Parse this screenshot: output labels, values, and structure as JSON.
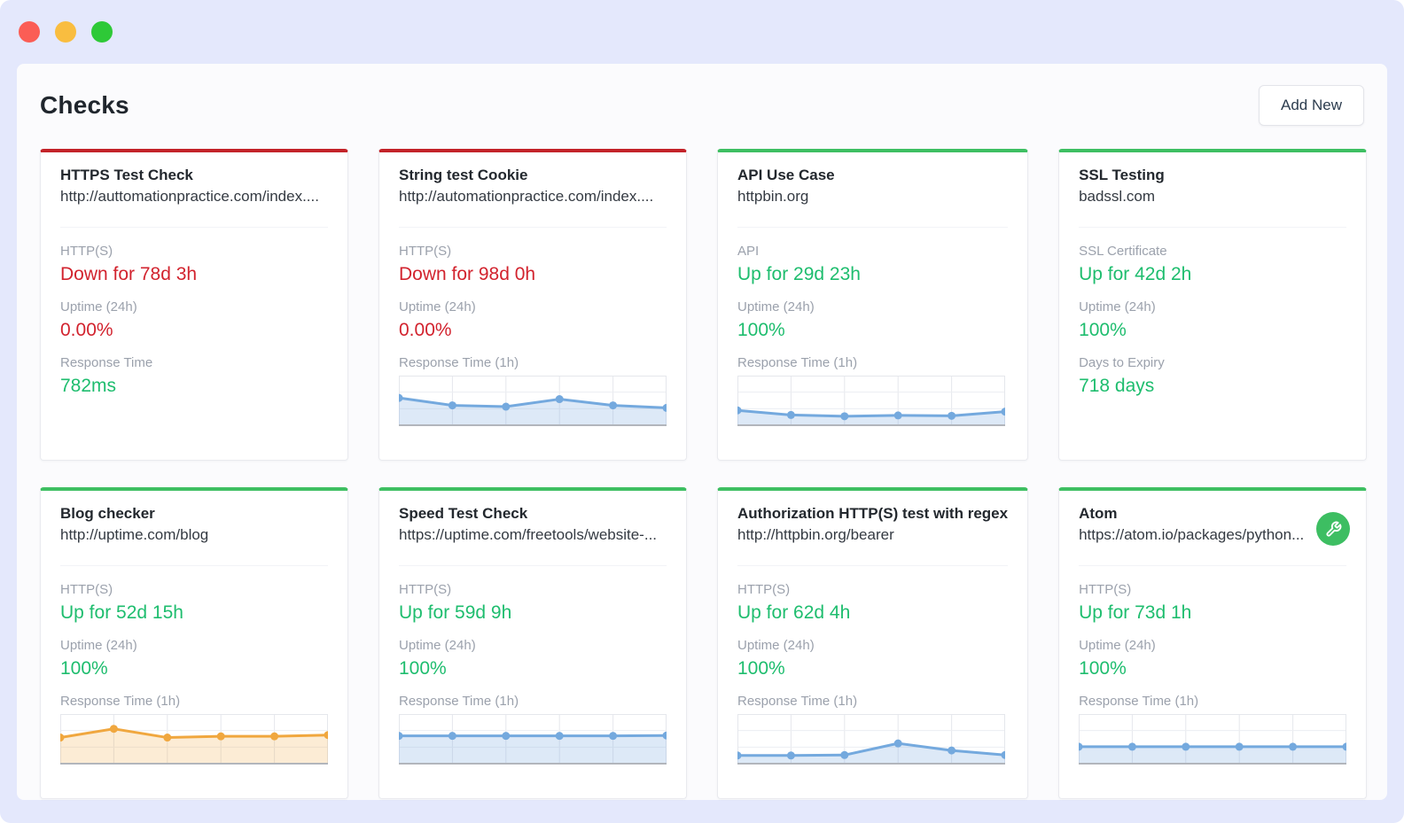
{
  "window": {
    "traffic_lights": [
      "#fb5d55",
      "#f9bd40",
      "#2ec937"
    ]
  },
  "header": {
    "title": "Checks",
    "add_button_label": "Add New"
  },
  "colors": {
    "up_text": "#1ebd6e",
    "down_text": "#d2232e",
    "up_border": "#3ebf62",
    "down_border": "#c32329",
    "label_gray": "#9ba1ac",
    "blue_line": "#74a9de",
    "orange_line": "#f0a73f"
  },
  "cards": [
    {
      "name": "HTTPS Test Check",
      "url": "http://auttomationpractice.com/index....",
      "status": "down",
      "sections": [
        {
          "label": "HTTP(S)",
          "value": "Down for 78d 3h",
          "value_color": "red"
        },
        {
          "label": "Uptime (24h)",
          "value": "0.00%",
          "value_color": "red"
        },
        {
          "label": "Response Time",
          "value": "782ms",
          "value_color": "green"
        }
      ]
    },
    {
      "name": "String test Cookie",
      "url": "http://automationpractice.com/index....",
      "status": "down",
      "sections": [
        {
          "label": "HTTP(S)",
          "value": "Down for 98d 0h",
          "value_color": "red"
        },
        {
          "label": "Uptime (24h)",
          "value": "0.00%",
          "value_color": "red"
        },
        {
          "label": "Response Time (1h)",
          "chart": 0
        }
      ]
    },
    {
      "name": "API Use Case",
      "url": "httpbin.org",
      "status": "up",
      "sections": [
        {
          "label": "API",
          "value": "Up for 29d 23h",
          "value_color": "green"
        },
        {
          "label": "Uptime (24h)",
          "value": "100%",
          "value_color": "green"
        },
        {
          "label": "Response Time (1h)",
          "chart": 1
        }
      ]
    },
    {
      "name": "SSL Testing",
      "url": "badssl.com",
      "status": "up",
      "sections": [
        {
          "label": "SSL Certificate",
          "value": "Up for 42d 2h",
          "value_color": "green"
        },
        {
          "label": "Uptime (24h)",
          "value": "100%",
          "value_color": "green"
        },
        {
          "label": "Days to Expiry",
          "value": "718 days",
          "value_color": "green"
        }
      ]
    },
    {
      "name": "Blog checker",
      "url": "http://uptime.com/blog",
      "status": "up",
      "sections": [
        {
          "label": "HTTP(S)",
          "value": "Up for 52d 15h",
          "value_color": "green"
        },
        {
          "label": "Uptime (24h)",
          "value": "100%",
          "value_color": "green"
        },
        {
          "label": "Response Time (1h)",
          "chart": 2
        }
      ]
    },
    {
      "name": "Speed Test Check",
      "url": "https://uptime.com/freetools/website-...",
      "status": "up",
      "sections": [
        {
          "label": "HTTP(S)",
          "value": "Up for 59d 9h",
          "value_color": "green"
        },
        {
          "label": "Uptime (24h)",
          "value": "100%",
          "value_color": "green"
        },
        {
          "label": "Response Time (1h)",
          "chart": 3
        }
      ]
    },
    {
      "name": "Authorization HTTP(S) test with regex",
      "url": "http://httpbin.org/bearer",
      "status": "up",
      "sections": [
        {
          "label": "HTTP(S)",
          "value": "Up for 62d 4h",
          "value_color": "green"
        },
        {
          "label": "Uptime (24h)",
          "value": "100%",
          "value_color": "green"
        },
        {
          "label": "Response Time (1h)",
          "chart": 4
        }
      ]
    },
    {
      "name": "Atom",
      "url": "https://atom.io/packages/python...",
      "status": "up",
      "badge": "wrench",
      "sections": [
        {
          "label": "HTTP(S)",
          "value": "Up for 73d 1h",
          "value_color": "green"
        },
        {
          "label": "Uptime (24h)",
          "value": "100%",
          "value_color": "green"
        },
        {
          "label": "Response Time (1h)",
          "chart": 5
        }
      ]
    }
  ],
  "chart_data": [
    {
      "type": "area",
      "card": "String test Cookie",
      "title": "Response Time (1h)",
      "color": "#74a9de",
      "fill": "rgba(133,177,227,0.28)",
      "x": [
        0,
        0.2,
        0.4,
        0.6,
        0.8,
        1.0
      ],
      "values": [
        0.55,
        0.37,
        0.34,
        0.52,
        0.37,
        0.31
      ],
      "ylim": [
        0,
        1
      ],
      "grid": true,
      "legend": false
    },
    {
      "type": "area",
      "card": "API Use Case",
      "title": "Response Time (1h)",
      "color": "#74a9de",
      "fill": "rgba(133,177,227,0.28)",
      "x": [
        0,
        0.2,
        0.4,
        0.6,
        0.8,
        1.0
      ],
      "values": [
        0.25,
        0.14,
        0.11,
        0.13,
        0.12,
        0.22
      ],
      "ylim": [
        0,
        1
      ],
      "grid": true,
      "legend": false
    },
    {
      "type": "area",
      "card": "Blog checker",
      "title": "Response Time (1h)",
      "color": "#f0a73f",
      "fill": "rgba(240,167,63,0.22)",
      "x": [
        0,
        0.2,
        0.4,
        0.6,
        0.8,
        1.0
      ],
      "values": [
        0.52,
        0.73,
        0.52,
        0.55,
        0.55,
        0.58
      ],
      "ylim": [
        0,
        1
      ],
      "grid": true,
      "legend": false
    },
    {
      "type": "area",
      "card": "Speed Test Check",
      "title": "Response Time (1h)",
      "color": "#74a9de",
      "fill": "rgba(133,177,227,0.28)",
      "x": [
        0,
        0.2,
        0.4,
        0.6,
        0.8,
        1.0
      ],
      "values": [
        0.56,
        0.56,
        0.56,
        0.56,
        0.56,
        0.57
      ],
      "ylim": [
        0,
        1
      ],
      "grid": true,
      "legend": false
    },
    {
      "type": "area",
      "card": "Authorization HTTP(S) test with regex",
      "title": "Response Time (1h)",
      "color": "#74a9de",
      "fill": "rgba(133,177,227,0.28)",
      "x": [
        0,
        0.2,
        0.4,
        0.6,
        0.8,
        1.0
      ],
      "values": [
        0.09,
        0.09,
        0.1,
        0.38,
        0.21,
        0.1
      ],
      "ylim": [
        0,
        1
      ],
      "grid": true,
      "legend": false
    },
    {
      "type": "area",
      "card": "Atom",
      "title": "Response Time (1h)",
      "color": "#74a9de",
      "fill": "rgba(133,177,227,0.28)",
      "x": [
        0,
        0.2,
        0.4,
        0.6,
        0.8,
        1.0
      ],
      "values": [
        0.3,
        0.3,
        0.3,
        0.3,
        0.3,
        0.3
      ],
      "ylim": [
        0,
        1
      ],
      "grid": true,
      "legend": false
    }
  ]
}
